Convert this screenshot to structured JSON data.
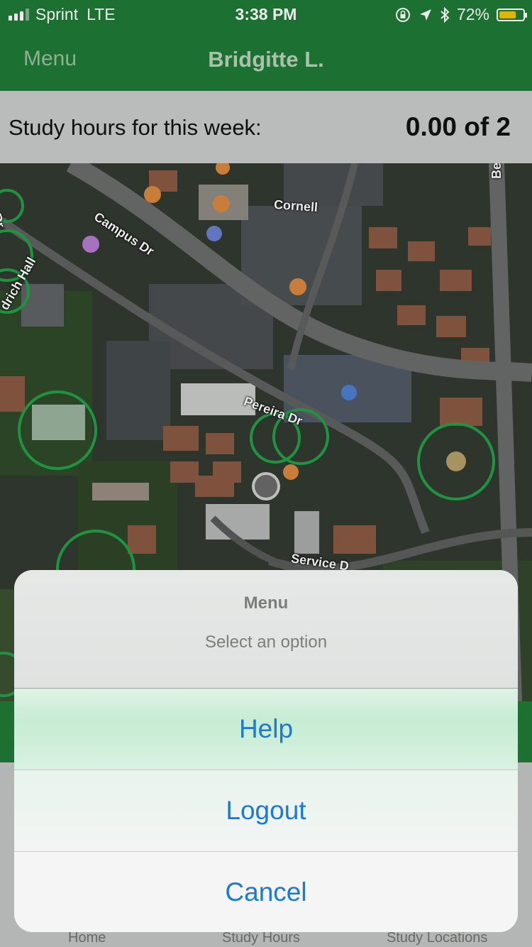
{
  "status_bar": {
    "carrier": "Sprint",
    "network": "LTE",
    "time": "3:38 PM",
    "battery_percent": "72%",
    "battery_level": 0.72,
    "icons": [
      "signal-icon",
      "orientation-lock-icon",
      "location-arrow-icon",
      "bluetooth-icon",
      "battery-icon"
    ]
  },
  "nav": {
    "menu_label": "Menu",
    "title": "Bridgitte L."
  },
  "study_hours": {
    "label": "Study hours for this week:",
    "value": "0.00 of 2"
  },
  "map": {
    "labels": {
      "campus_dr": "Campus Dr",
      "cornell": "Cornell",
      "pereira_dr": "Pereira Dr",
      "hall": "drich Hall",
      "service": "Service D",
      "dr_left": "Dr",
      "be": "Be"
    },
    "colors": {
      "circle": "#22a046",
      "user_dot": "#6b6b6b"
    }
  },
  "tabs": {
    "home": "Home",
    "study_hours": "Study Hours",
    "study_locations": "Study Locations"
  },
  "action_sheet": {
    "title": "Menu",
    "subtitle": "Select an option",
    "help": "Help",
    "logout": "Logout",
    "cancel": "Cancel",
    "button_color": "#1b7ad6"
  }
}
